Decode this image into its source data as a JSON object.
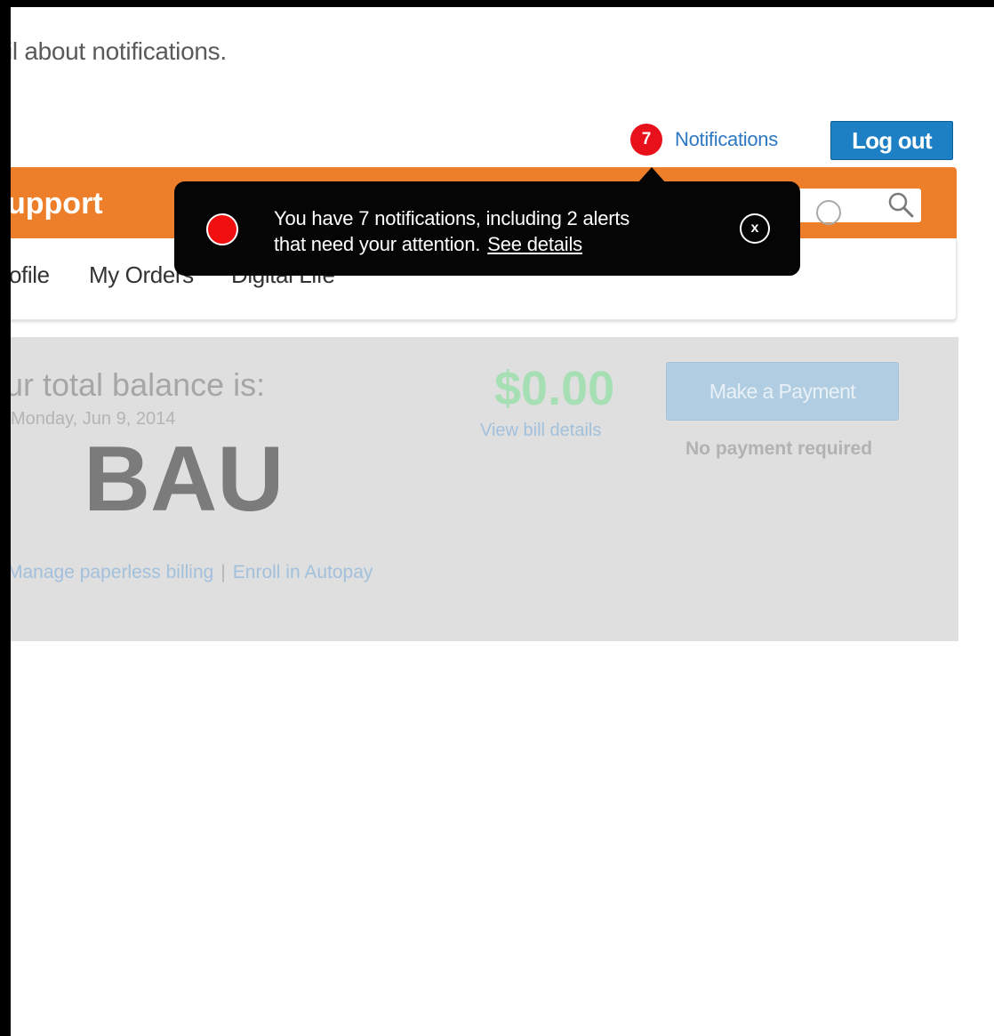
{
  "intro_text": "il about notifications.",
  "header": {
    "notifications_count": "7",
    "notifications_label": "Notifications",
    "logout_label": "Log out"
  },
  "brand": {
    "title": "upport",
    "color": "#ed7f2b"
  },
  "search": {
    "icon": "magnifier-icon"
  },
  "nav": {
    "items": [
      {
        "label": "ofile"
      },
      {
        "label": "My Orders"
      },
      {
        "label": "Digital Life"
      }
    ]
  },
  "balance": {
    "title": "ur total balance is:",
    "date": "Monday, Jun 9, 2014",
    "overlay_label": "BAU",
    "amount": "$0.00",
    "bill_link": "View bill details",
    "pay_button": "Make a Payment",
    "payment_status": "No payment required",
    "links": [
      "Manage paperless billing",
      "Enroll in Autopay"
    ],
    "separator": "|"
  },
  "popup": {
    "line1": "You have 7 notifications, including 2 alerts",
    "line2": "that need your attention.",
    "link": "See details",
    "close_label": "x"
  },
  "colors": {
    "alert_red": "#e8101a",
    "link_blue": "#2d78c2",
    "button_blue": "#1d7fc4",
    "amount_green": "#a6dfb4"
  }
}
